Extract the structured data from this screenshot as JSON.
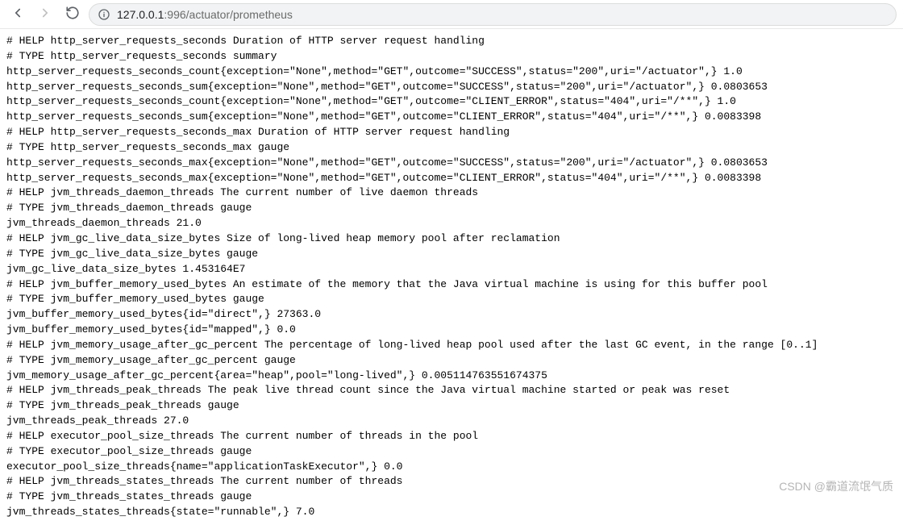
{
  "url": {
    "host": "127.0.0.1",
    "port": ":996",
    "path": "/actuator/prometheus"
  },
  "metrics_lines": [
    "# HELP http_server_requests_seconds Duration of HTTP server request handling",
    "# TYPE http_server_requests_seconds summary",
    "http_server_requests_seconds_count{exception=\"None\",method=\"GET\",outcome=\"SUCCESS\",status=\"200\",uri=\"/actuator\",} 1.0",
    "http_server_requests_seconds_sum{exception=\"None\",method=\"GET\",outcome=\"SUCCESS\",status=\"200\",uri=\"/actuator\",} 0.0803653",
    "http_server_requests_seconds_count{exception=\"None\",method=\"GET\",outcome=\"CLIENT_ERROR\",status=\"404\",uri=\"/**\",} 1.0",
    "http_server_requests_seconds_sum{exception=\"None\",method=\"GET\",outcome=\"CLIENT_ERROR\",status=\"404\",uri=\"/**\",} 0.0083398",
    "# HELP http_server_requests_seconds_max Duration of HTTP server request handling",
    "# TYPE http_server_requests_seconds_max gauge",
    "http_server_requests_seconds_max{exception=\"None\",method=\"GET\",outcome=\"SUCCESS\",status=\"200\",uri=\"/actuator\",} 0.0803653",
    "http_server_requests_seconds_max{exception=\"None\",method=\"GET\",outcome=\"CLIENT_ERROR\",status=\"404\",uri=\"/**\",} 0.0083398",
    "# HELP jvm_threads_daemon_threads The current number of live daemon threads",
    "# TYPE jvm_threads_daemon_threads gauge",
    "jvm_threads_daemon_threads 21.0",
    "# HELP jvm_gc_live_data_size_bytes Size of long-lived heap memory pool after reclamation",
    "# TYPE jvm_gc_live_data_size_bytes gauge",
    "jvm_gc_live_data_size_bytes 1.453164E7",
    "# HELP jvm_buffer_memory_used_bytes An estimate of the memory that the Java virtual machine is using for this buffer pool",
    "# TYPE jvm_buffer_memory_used_bytes gauge",
    "jvm_buffer_memory_used_bytes{id=\"direct\",} 27363.0",
    "jvm_buffer_memory_used_bytes{id=\"mapped\",} 0.0",
    "# HELP jvm_memory_usage_after_gc_percent The percentage of long-lived heap pool used after the last GC event, in the range [0..1]",
    "# TYPE jvm_memory_usage_after_gc_percent gauge",
    "jvm_memory_usage_after_gc_percent{area=\"heap\",pool=\"long-lived\",} 0.005114763551674375",
    "# HELP jvm_threads_peak_threads The peak live thread count since the Java virtual machine started or peak was reset",
    "# TYPE jvm_threads_peak_threads gauge",
    "jvm_threads_peak_threads 27.0",
    "# HELP executor_pool_size_threads The current number of threads in the pool",
    "# TYPE executor_pool_size_threads gauge",
    "executor_pool_size_threads{name=\"applicationTaskExecutor\",} 0.0",
    "# HELP jvm_threads_states_threads The current number of threads",
    "# TYPE jvm_threads_states_threads gauge",
    "jvm_threads_states_threads{state=\"runnable\",} 7.0"
  ],
  "watermark": "CSDN @霸道流氓气质"
}
